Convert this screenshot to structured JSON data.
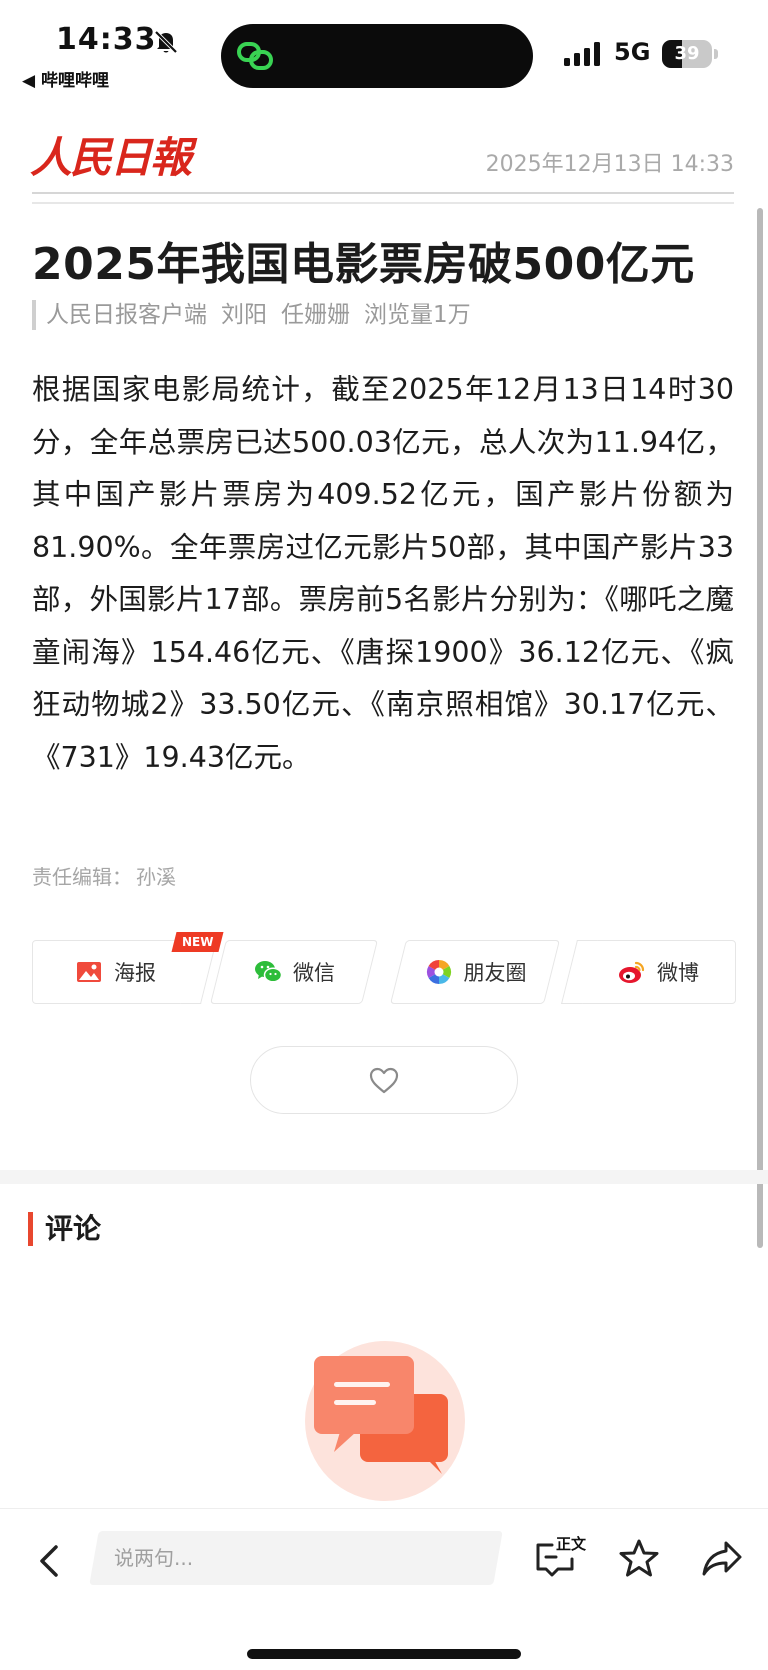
{
  "status_bar": {
    "time": "14:33",
    "back_app": "◀ 哔哩哔哩",
    "network": "5G",
    "battery": "39",
    "battery_level": 0.39
  },
  "header": {
    "brand": "人民日報",
    "datetime": "2025年12月13日 14:33"
  },
  "article": {
    "title": "2025年我国电影票房破500亿元",
    "byline": [
      "人民日报客户端",
      "刘阳",
      "任姗姗",
      "浏览量1万"
    ],
    "body": "根据国家电影局统计，截至2025年12月13日14时30分，全年总票房已达500.03亿元，总人次为11.94亿，其中国产影片票房为409.52亿元，国产影片份额为81.90%。全年票房过亿元影片50部，其中国产影片33部，外国影片17部。票房前5名影片分别为：《哪吒之魔童闹海》154.46亿元、《唐探1900》36.12亿元、《疯狂动物城2》33.50亿元、《南京照相馆》30.17亿元、《731》19.43亿元。",
    "editor_label": "责任编辑：",
    "editor_name": "孙溪"
  },
  "share": {
    "new_badge": "NEW",
    "items": [
      {
        "label": "海报",
        "icon": "poster-icon"
      },
      {
        "label": "微信",
        "icon": "wechat-icon"
      },
      {
        "label": "朋友圈",
        "icon": "moments-icon"
      },
      {
        "label": "微博",
        "icon": "weibo-icon"
      }
    ]
  },
  "comments": {
    "title": "评论"
  },
  "bottom_bar": {
    "input_placeholder": "说两句...",
    "text_toggle": "正文"
  },
  "colors": {
    "brand_red": "#d9261c",
    "accent": "#e8472f"
  }
}
